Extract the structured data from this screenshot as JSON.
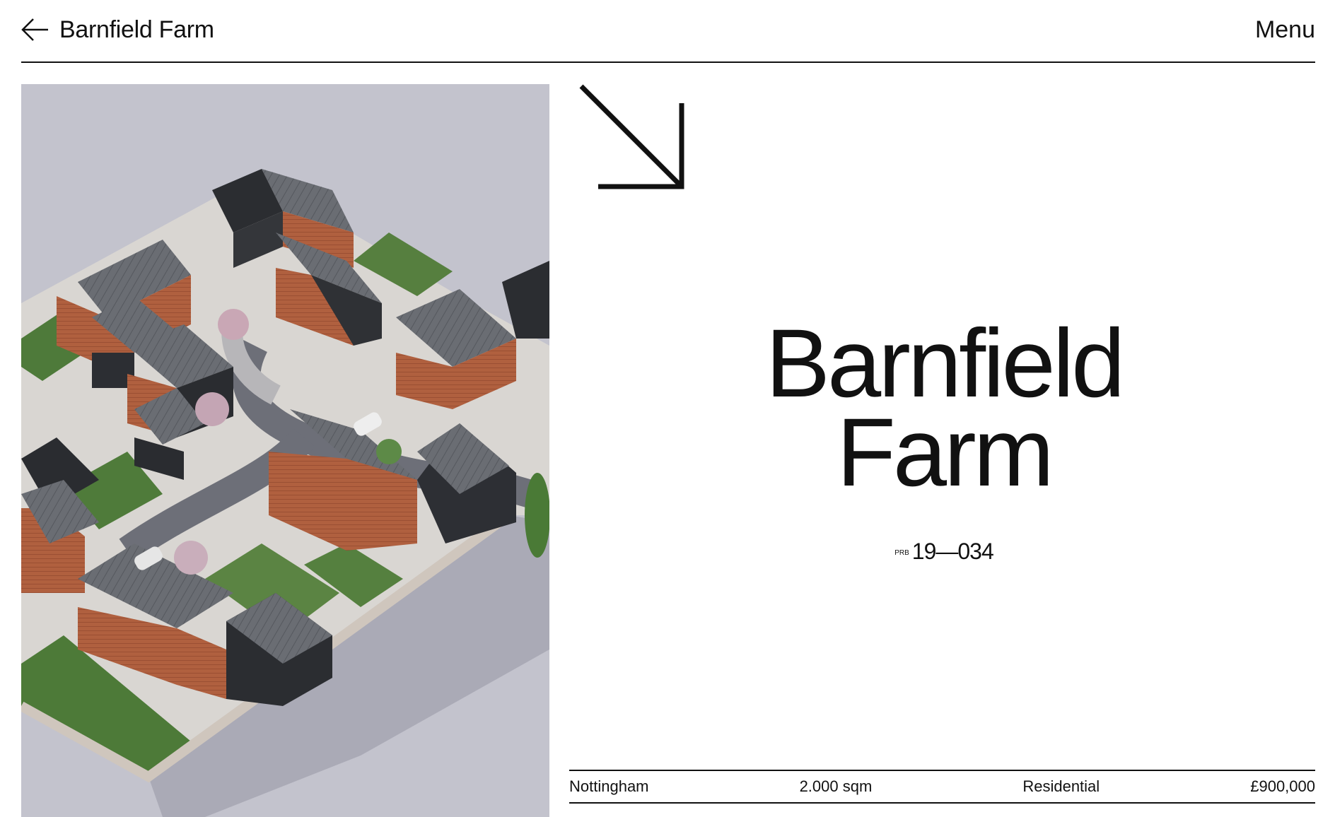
{
  "header": {
    "site_title": "Barnfield Farm",
    "menu_label": "Menu"
  },
  "hero": {
    "image_alt": "Aerial render of the Barnfield Farm residential development"
  },
  "project": {
    "title_line1": "Barnfield",
    "title_line2": "Farm",
    "code_prefix": "PRB",
    "code": "19—034"
  },
  "facts": {
    "location": "Nottingham",
    "area": "2.000 sqm",
    "type": "Residential",
    "price": "£900,000"
  },
  "colors": {
    "text": "#111111",
    "background": "#ffffff",
    "image_sky": "#c3c3cd"
  },
  "icons": {
    "back": "arrow-left-icon",
    "corner": "arrow-down-right-icon"
  }
}
